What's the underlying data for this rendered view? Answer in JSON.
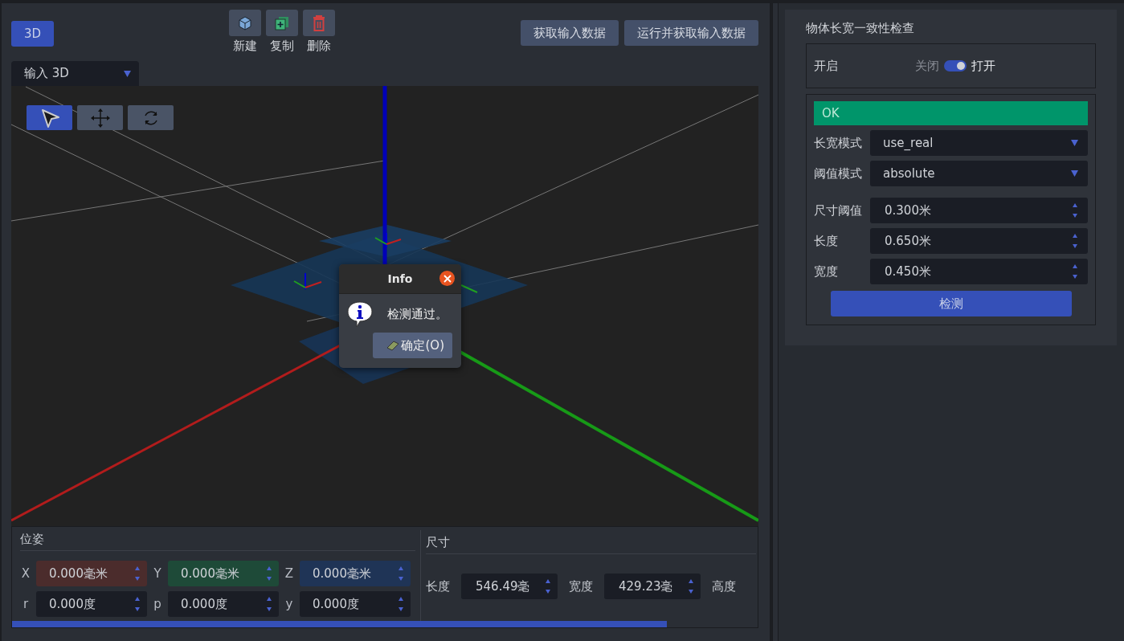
{
  "mode_button": {
    "label": "3D",
    "selected": true
  },
  "toolbar": [
    {
      "kind": "new",
      "label": "新建"
    },
    {
      "kind": "copy",
      "label": "复制"
    },
    {
      "kind": "delete",
      "label": "删除"
    }
  ],
  "actions": [
    "获取输入数据",
    "运行并获取输入数据"
  ],
  "input_select": {
    "value": "输入 3D"
  },
  "view_tools": [
    {
      "kind": "select",
      "selected": true
    },
    {
      "kind": "move",
      "selected": false
    },
    {
      "kind": "rotate",
      "selected": false
    }
  ],
  "dialog": {
    "title": "Info",
    "message": "检测通过。",
    "button": "确定(O)"
  },
  "pose": {
    "title": "位姿",
    "fields": [
      {
        "label": "X",
        "value": "0.000毫米",
        "color": "#4b2c2c"
      },
      {
        "label": "Y",
        "value": "0.000毫米",
        "color": "#1e4a38"
      },
      {
        "label": "Z",
        "value": "0.000毫米",
        "color": "#1f3456"
      },
      {
        "label": "r",
        "value": "0.000度",
        "color": "#1a1d25"
      },
      {
        "label": "p",
        "value": "0.000度",
        "color": "#1a1d25"
      },
      {
        "label": "y",
        "value": "0.000度",
        "color": "#1a1d25"
      }
    ]
  },
  "size": {
    "title": "尺寸",
    "fields": [
      {
        "label": "长度",
        "value": "546.49毫"
      },
      {
        "label": "宽度",
        "value": "429.23毫"
      }
    ],
    "extra_label": "高度"
  },
  "check_panel": {
    "title": "物体长宽一致性检查",
    "enable": {
      "label": "开启",
      "off_label": "关闭",
      "on_label": "打开",
      "on": true
    },
    "status": {
      "text": "OK",
      "kind": "ok"
    },
    "selects": [
      {
        "label": "长宽模式",
        "value": "use_real"
      },
      {
        "label": "阈值模式",
        "value": "absolute"
      }
    ],
    "spins": [
      {
        "label": "尺寸阈值",
        "value": "0.300米"
      },
      {
        "label": "长度",
        "value": "0.650米"
      },
      {
        "label": "宽度",
        "value": "0.450米"
      }
    ],
    "button": "检测"
  }
}
